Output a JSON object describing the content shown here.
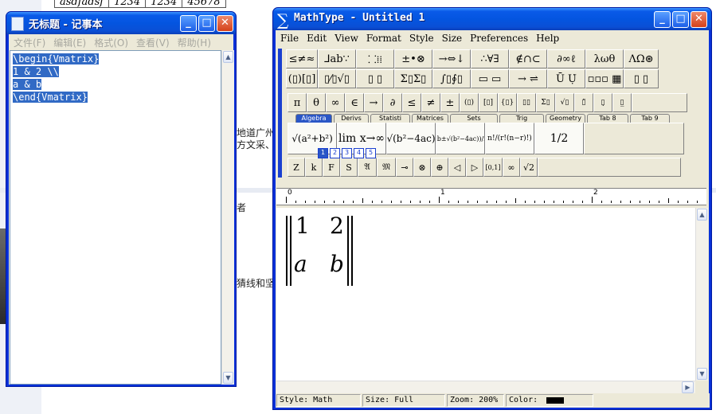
{
  "background_page": {
    "table_cells": [
      "asdfadsf",
      "1234",
      "1234",
      "45678"
    ],
    "snippet_1": "地道广州",
    "snippet_2": "方文采、",
    "snippet_3": "者",
    "snippet_4": "猜线和坚"
  },
  "notepad": {
    "title": "无标题 - 记事本",
    "menu": [
      "文件(F)",
      "编辑(E)",
      "格式(O)",
      "查看(V)",
      "帮助(H)"
    ],
    "lines": [
      "\\begin{Vmatrix}",
      "1 & 2 \\\\",
      "a & b",
      "\\end{Vmatrix}"
    ]
  },
  "mathtype": {
    "title": "MathType - Untitled 1",
    "menu": [
      "File",
      "Edit",
      "View",
      "Format",
      "Style",
      "Size",
      "Preferences",
      "Help"
    ],
    "row1": [
      "≤≠≈",
      "⅃ab∵",
      "⸬⁞⁞",
      "±•⊗",
      "→⇔↓",
      "∴∀∃",
      "∉∩⊂",
      "∂∞ℓ",
      "λωθ",
      "ΛΩ⊛"
    ],
    "row2": [
      "(▯)[▯]",
      "▯⁄▯√▯",
      "▯ ▯",
      "Σ▯Σ▯",
      "∫▯∮▯",
      "▭ ▭",
      "→ ⇌",
      "Ū Ụ̇",
      "▫▫▫ ▦",
      "▯ ▯"
    ],
    "row3": [
      "π",
      "θ",
      "∞",
      "∈",
      "→",
      "∂",
      "≤",
      "≠",
      "±",
      "(▯)",
      "[▯]",
      "{▯}",
      "▯▯",
      "Σ▯",
      "√▯",
      "▯̈",
      "▯̣",
      "▯̲"
    ],
    "tabs": [
      "Algebra",
      "Derivs",
      "Statisti",
      "Matrices",
      "Sets",
      "Trig",
      "Geometry",
      "Tab 8",
      "Tab 9"
    ],
    "templates": [
      "√(a²+b²)",
      "lim x→∞",
      "√(b²−4ac)",
      "(−b±√(b²−4ac))/2a",
      "n!/(r!(n−r)!)",
      "1/2",
      ""
    ],
    "row5": [
      "Z",
      "k",
      "F",
      "S",
      "𝔄",
      "𝔐",
      "⊸",
      "⊗",
      "⊕",
      "◁",
      "▷",
      "[0,1]",
      "∞",
      "√2"
    ],
    "small_icons": [
      "1",
      "2",
      "3",
      "4",
      "5"
    ],
    "ruler_labels": [
      "0",
      "1",
      "2"
    ],
    "matrix": [
      [
        "1",
        "2"
      ],
      [
        "a",
        "b"
      ]
    ],
    "status": {
      "style": "Style: Math",
      "size": "Size: Full",
      "zoom": "Zoom: 200%",
      "color": "Color:"
    }
  },
  "colors": {
    "xp_title_blue": "#0455e0",
    "selection": "#316ac5",
    "mathtype_accent": "#1a3fd0"
  }
}
